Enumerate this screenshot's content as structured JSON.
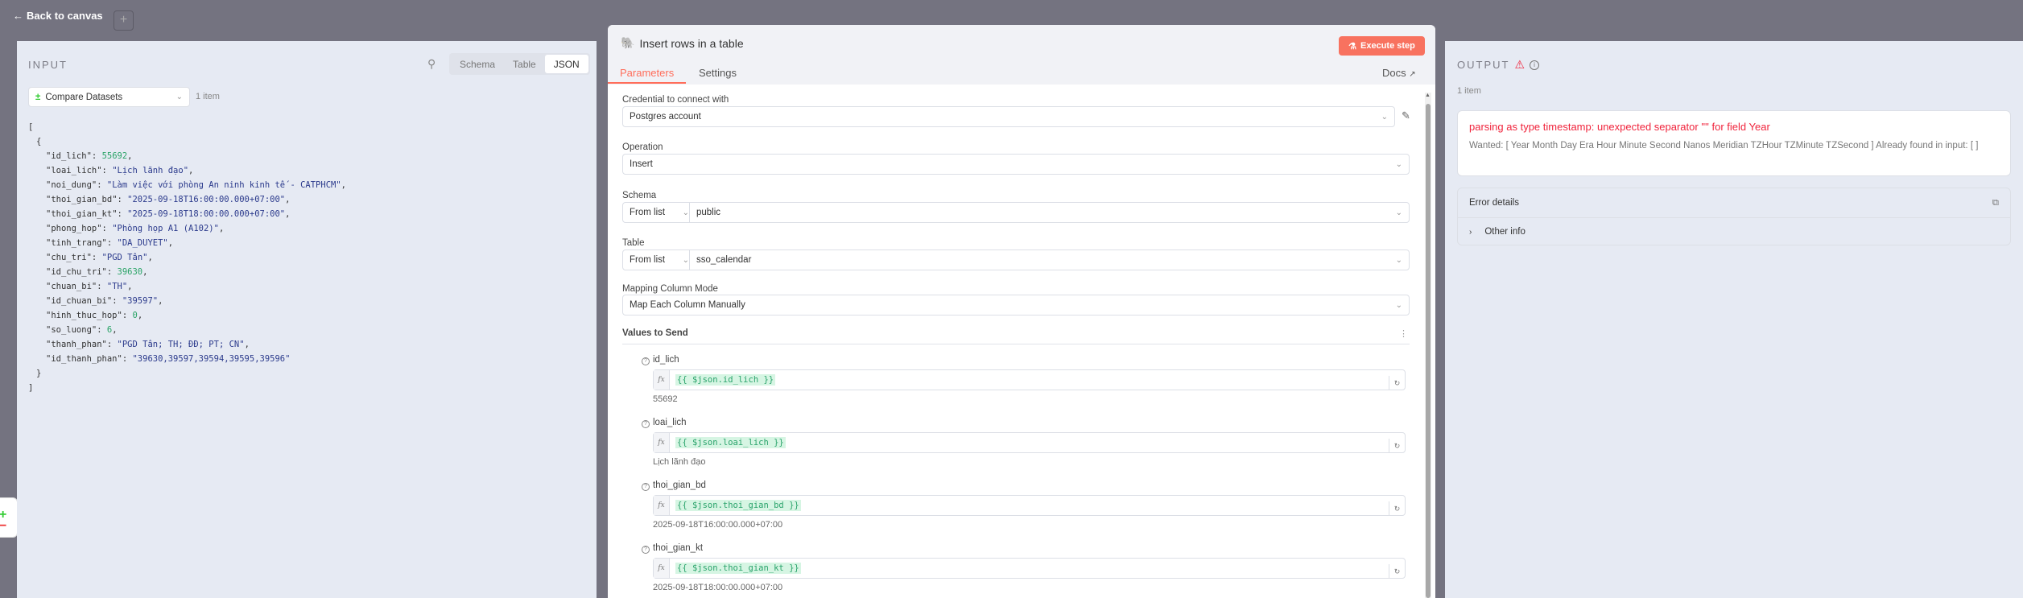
{
  "topbar": {
    "back_label": "Back to canvas",
    "add_label": "+"
  },
  "input": {
    "title": "INPUT",
    "tabs": [
      "Schema",
      "Table",
      "JSON"
    ],
    "selected_tab": "JSON",
    "node_select": "Compare Datasets",
    "item_count": "1 item",
    "json": [
      {
        "k": "id_lich",
        "v": "55692",
        "t": "n"
      },
      {
        "k": "loai_lich",
        "v": "\"Lịch lãnh đạo\"",
        "t": "s"
      },
      {
        "k": "noi_dung",
        "v": "\"Làm việc với phòng An ninh kinh tế - CATPHCM\"",
        "t": "s"
      },
      {
        "k": "thoi_gian_bd",
        "v": "\"2025-09-18T16:00:00.000+07:00\"",
        "t": "s"
      },
      {
        "k": "thoi_gian_kt",
        "v": "\"2025-09-18T18:00:00.000+07:00\"",
        "t": "s"
      },
      {
        "k": "phong_hop",
        "v": "\"Phòng họp A1 (A102)\"",
        "t": "s"
      },
      {
        "k": "tinh_trang",
        "v": "\"DA_DUYET\"",
        "t": "s"
      },
      {
        "k": "chu_tri",
        "v": "\"PGD Tân\"",
        "t": "s"
      },
      {
        "k": "id_chu_tri",
        "v": "39630",
        "t": "n"
      },
      {
        "k": "chuan_bi",
        "v": "\"TH\"",
        "t": "s"
      },
      {
        "k": "id_chuan_bi",
        "v": "\"39597\"",
        "t": "s"
      },
      {
        "k": "hinh_thuc_hop",
        "v": "0",
        "t": "n"
      },
      {
        "k": "so_luong",
        "v": "6",
        "t": "n"
      },
      {
        "k": "thanh_phan",
        "v": "\"PGD Tân; TH; ĐĐ; PT; CN\"",
        "t": "s"
      },
      {
        "k": "id_thanh_phan",
        "v": "\"39630,39597,39594,39595,39596\"",
        "t": "s"
      }
    ]
  },
  "node": {
    "title": "Insert rows in a table",
    "execute_label": "Execute step",
    "tabs": [
      "Parameters",
      "Settings"
    ],
    "docs_label": "Docs",
    "credential_label": "Credential to connect with",
    "credential_value": "Postgres account",
    "operation_label": "Operation",
    "operation_value": "Insert",
    "schema_label": "Schema",
    "schema_mode": "From list",
    "schema_value": "public",
    "table_label": "Table",
    "table_mode": "From list",
    "table_value": "sso_calendar",
    "mapping_label": "Mapping Column Mode",
    "mapping_value": "Map Each Column Manually",
    "values_label": "Values to Send",
    "fields": [
      {
        "name": "id_lich",
        "expr": "{{ $json.id_lich }}",
        "preview": "55692"
      },
      {
        "name": "loai_lich",
        "expr": "{{ $json.loai_lich }}",
        "preview": "Lịch lãnh đạo"
      },
      {
        "name": "thoi_gian_bd",
        "expr": "{{ $json.thoi_gian_bd }}",
        "preview": "2025-09-18T16:00:00.000+07:00"
      },
      {
        "name": "thoi_gian_kt",
        "expr": "{{ $json.thoi_gian_kt }}",
        "preview": "2025-09-18T18:00:00.000+07:00"
      }
    ]
  },
  "output": {
    "title": "OUTPUT",
    "item_count": "1 item",
    "error_title": "parsing as type timestamp: unexpected separator '\"' for field Year",
    "error_desc": "Wanted: [ Year Month Day Era Hour Minute Second Nanos Meridian TZHour TZMinute TZSecond ] Already found in input: [ ]",
    "details_label": "Error details",
    "other_info": "Other info"
  },
  "colors": {
    "accent": "#ff6d5a",
    "error": "#f0243c",
    "number": "#29a366"
  }
}
